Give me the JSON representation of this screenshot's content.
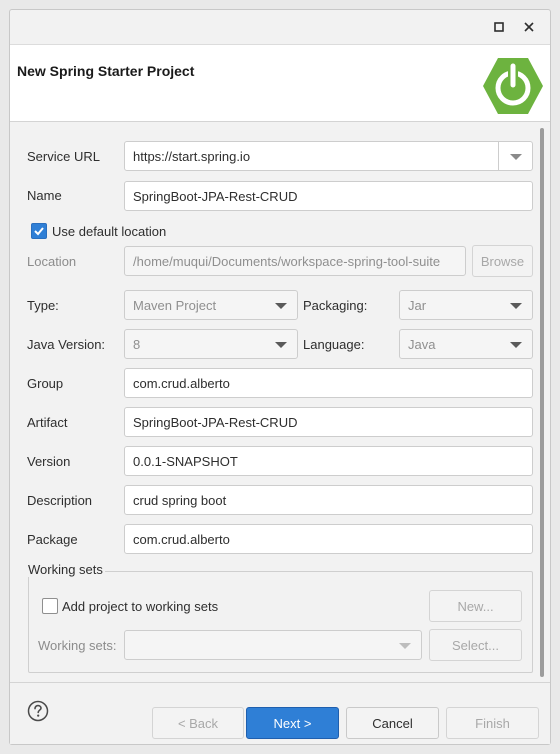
{
  "dialog": {
    "title": "New Spring Starter Project"
  },
  "titlebar": {
    "maximize_icon": "maximize-icon",
    "close_icon": "close-icon"
  },
  "form": {
    "service_url": {
      "label": "Service URL",
      "value": "https://start.spring.io"
    },
    "name": {
      "label": "Name",
      "value": "SpringBoot-JPA-Rest-CRUD"
    },
    "use_default_location": {
      "label": "Use default location",
      "checked": true
    },
    "location": {
      "label": "Location",
      "value": "/home/muqui/Documents/workspace-spring-tool-suite",
      "browse_label": "Browse"
    },
    "type": {
      "label": "Type:",
      "value": "Maven Project"
    },
    "packaging": {
      "label": "Packaging:",
      "value": "Jar"
    },
    "java_version": {
      "label": "Java Version:",
      "value": "8"
    },
    "language": {
      "label": "Language:",
      "value": "Java"
    },
    "group": {
      "label": "Group",
      "value": "com.crud.alberto"
    },
    "artifact": {
      "label": "Artifact",
      "value": "SpringBoot-JPA-Rest-CRUD"
    },
    "version": {
      "label": "Version",
      "value": "0.0.1-SNAPSHOT"
    },
    "description": {
      "label": "Description",
      "value": "crud spring boot"
    },
    "package": {
      "label": "Package",
      "value": "com.crud.alberto"
    }
  },
  "working_sets": {
    "group_title": "Working sets",
    "add_label": "Add project to working sets",
    "add_checked": false,
    "new_label": "New...",
    "sets_label": "Working sets:",
    "select_label": "Select..."
  },
  "footer": {
    "help_icon": "help-icon",
    "back_label": "< Back",
    "next_label": "Next >",
    "cancel_label": "Cancel",
    "finish_label": "Finish"
  },
  "colors": {
    "accent": "#2f7fd6",
    "spring_green": "#6db33f"
  }
}
